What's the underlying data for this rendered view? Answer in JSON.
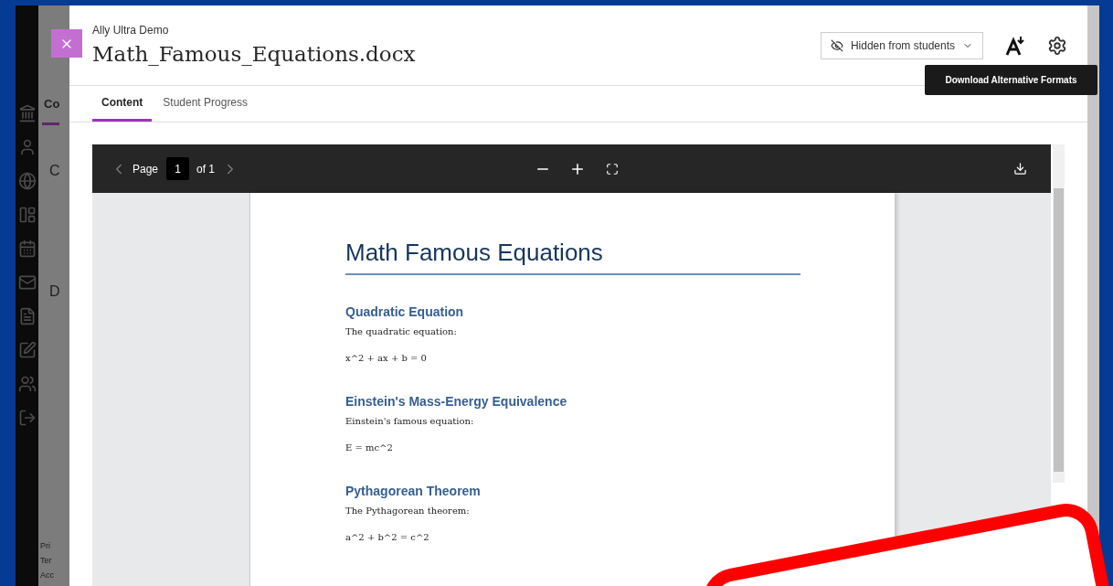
{
  "background": {
    "tab": "Co",
    "headings": [
      "C",
      "D"
    ],
    "footer": [
      "Pri",
      "Ter",
      "Acc"
    ]
  },
  "panel": {
    "course": "Ally Ultra Demo",
    "title": "Math_Famous_Equations.docx",
    "visibility": "Hidden from students",
    "tooltip": "Download Alternative Formats",
    "tabs": [
      {
        "label": "Content",
        "selected": true
      },
      {
        "label": "Student Progress",
        "selected": false
      }
    ]
  },
  "viewer": {
    "page_label": "Page",
    "page": "1",
    "of": "of 1"
  },
  "document": {
    "title": "Math Famous Equations",
    "sections": [
      {
        "heading": "Quadratic Equation",
        "text": "The quadratic equation:",
        "formula": "x^2 + ax + b = 0"
      },
      {
        "heading": "Einstein's Mass-Energy Equivalence",
        "text": "Einstein's famous equation:",
        "formula": "E = mc^2"
      },
      {
        "heading": "Pythagorean Theorem",
        "text": "The Pythagorean theorem:",
        "formula": "a^2 + b^2 = c^2"
      }
    ]
  }
}
